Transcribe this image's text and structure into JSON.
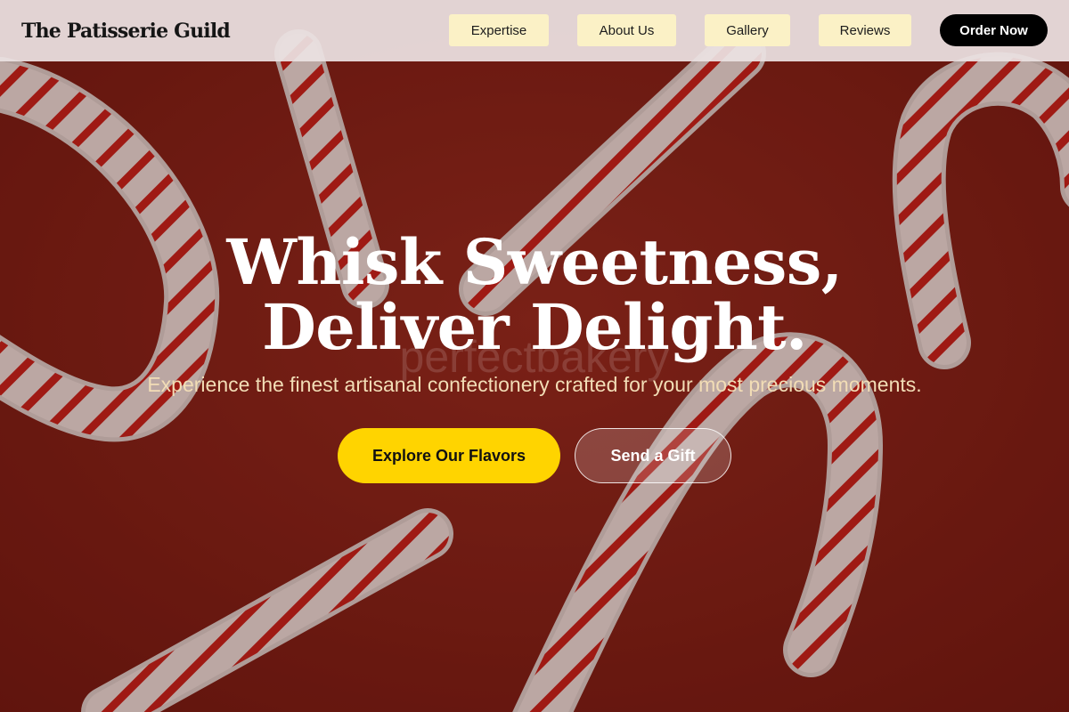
{
  "brand": {
    "name": "The Patisserie Guild"
  },
  "nav": {
    "items": [
      {
        "label": "Expertise"
      },
      {
        "label": "About Us"
      },
      {
        "label": "Gallery"
      },
      {
        "label": "Reviews"
      }
    ],
    "cta_label": "Order Now"
  },
  "hero": {
    "headline_line1": "Whisk Sweetness,",
    "headline_line2": "Deliver Delight.",
    "watermark": "perfectbakery",
    "subtitle": "Experience the finest artisanal confectionery crafted for your most precious moments.",
    "primary_cta": "Explore Our Flavors",
    "secondary_cta": "Send a Gift",
    "background_image": "candy-canes-on-red-background"
  },
  "colors": {
    "background_red": "#7a1c14",
    "nav_button_bg": "#fbf1c6",
    "primary_cta_bg": "#ffd400",
    "order_button_bg": "#000000",
    "subtitle_text": "#f2ddb6"
  }
}
